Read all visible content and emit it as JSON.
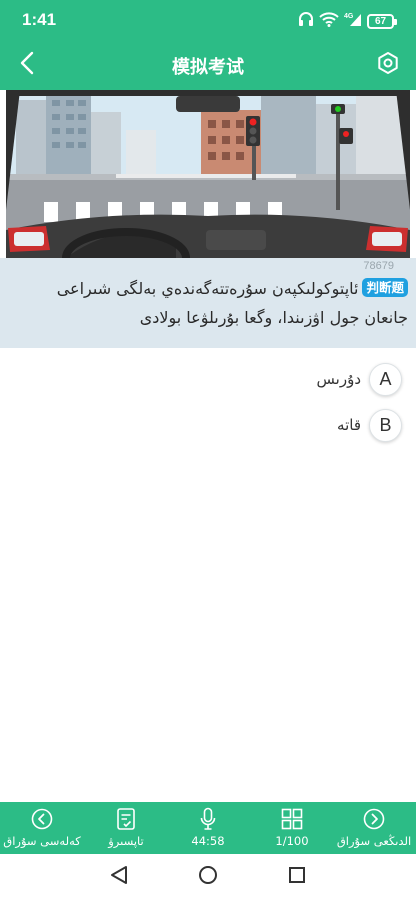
{
  "status": {
    "time": "1:41",
    "battery": "67",
    "network": "4G"
  },
  "header": {
    "title": "模拟考试"
  },
  "question": {
    "id": "78679",
    "type_badge": "判断题",
    "text": "ئاپتوكولىكپەن سۇرەتتەگەندەي بەلگى شىراعى جانعان جول اۋزىندا، وگعا بۇرىلۋعا بولادى"
  },
  "options": [
    {
      "letter": "A",
      "label": "دۇرىس"
    },
    {
      "letter": "B",
      "label": "قاتە"
    }
  ],
  "bottom_nav": {
    "prev_label": "كەلەسى سۇراق",
    "submit_label": "تاپسىرۋ",
    "timer": "44:58",
    "progress": "1/100",
    "next_label": "الدىڭعى سۇراق"
  },
  "colors": {
    "primary": "#2cbc86",
    "question_bg": "#dce7ee",
    "badge": "#1fa0e0"
  }
}
